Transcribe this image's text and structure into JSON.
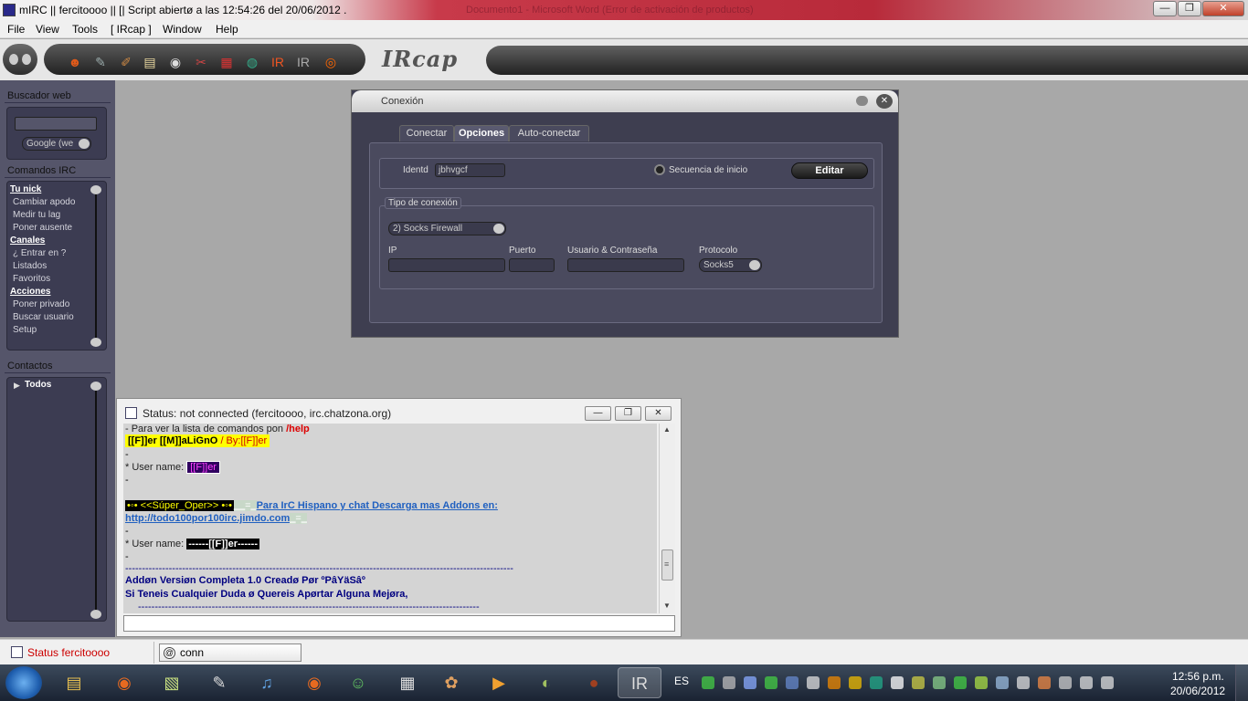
{
  "window": {
    "title": "mIRC || fercitoooo || [| Script abiertø a las 12:54:26 del 20/06/2012 .",
    "ghost_title": "Documento1 - Microsoft Word (Error de activación de productos)",
    "close_glyph": "✕",
    "max_glyph": "❐",
    "min_glyph": "—"
  },
  "menu": [
    "File",
    "View",
    "Tools",
    "[ IRcap ]",
    "Window",
    "Help"
  ],
  "toolbar": {
    "icons": [
      {
        "name": "smiley-icon",
        "glyph": "☻",
        "color": "#e05a1a"
      },
      {
        "name": "tools-icon",
        "glyph": "✎",
        "color": "#9aa"
      },
      {
        "name": "brush-icon",
        "glyph": "✐",
        "color": "#c84"
      },
      {
        "name": "note-icon",
        "glyph": "▤",
        "color": "#ead9a0"
      },
      {
        "name": "disk-icon",
        "glyph": "◉",
        "color": "#ddd"
      },
      {
        "name": "wrench-icon",
        "glyph": "✂",
        "color": "#c44"
      },
      {
        "name": "gift-icon",
        "glyph": "▦",
        "color": "#d33"
      },
      {
        "name": "globe-icon",
        "glyph": "◍",
        "color": "#3a8"
      },
      {
        "name": "ircap-icon",
        "glyph": "IR",
        "color": "#e52"
      },
      {
        "name": "ir-logo-icon",
        "glyph": "IR",
        "color": "#aaa"
      },
      {
        "name": "lifebuoy-icon",
        "glyph": "◎",
        "color": "#f60"
      }
    ],
    "logo": "IRcap"
  },
  "sidebar": {
    "web_title": "Buscador web",
    "web_select": "Google (we",
    "cmd_title": "Comandos IRC",
    "commands": [
      {
        "label": "Tu nick",
        "head": true
      },
      {
        "label": "Cambiar apodo",
        "head": false
      },
      {
        "label": "Medir tu lag",
        "head": false
      },
      {
        "label": "Poner ausente",
        "head": false
      },
      {
        "label": "Canales",
        "head": true
      },
      {
        "label": "¿ Entrar en ?",
        "head": false
      },
      {
        "label": "Listados",
        "head": false
      },
      {
        "label": "Favoritos",
        "head": false
      },
      {
        "label": "Acciones",
        "head": true
      },
      {
        "label": "Poner privado",
        "head": false
      },
      {
        "label": "Buscar usuario",
        "head": false
      },
      {
        "label": "Setup",
        "head": false
      }
    ],
    "contacts_title": "Contactos",
    "contacts_group": "Todos"
  },
  "dialog": {
    "title": "Conexión",
    "tabs": [
      "Conectar",
      "Opciones",
      "Auto-conectar"
    ],
    "active_tab": "Opciones",
    "ident_label": "Identd",
    "ident_value": "jbhvgcf",
    "radio_label": "Secuencia de inicio",
    "edit_button": "Editar",
    "conn_legend": "Tipo de conexión",
    "conn_type": "2) Socks Firewall",
    "ip_label": "IP",
    "port_label": "Puerto",
    "userpass_label": "Usuario & Contraseña",
    "protocol_label": "Protocolo",
    "protocol_value": "Socks5"
  },
  "status_window": {
    "title": "Status: not connected (fercitoooo, irc.chatzona.org)",
    "lines": {
      "l1a": "- Para ver la lista de comandos pon ",
      "l1b": "/help",
      "l2a": "[[F]]er [[M]]aLiGnO ",
      "l2b": " / By:[[F]]er",
      "dash": "-",
      "user_label": "* User name: ",
      "user_value1": "[[F]]er",
      "super_oper": "•◦• <<Súper_Oper>> •◦•",
      "equals": "‗‗=‗",
      "promo": "Para IrC Hispano y chat Descarga mas Addons en:",
      "url": "http://todo100por100irc.jimdo.com",
      "equals2": "‗=‗",
      "user_value2": "------[[F]]er------",
      "separator": "--------------------------------------------------------------------------------------------------------------------",
      "addon1": "Addøn Versiøn Completa 1.0 Creadø Pør  ºPâYäSâº",
      "addon2": "Si Teneis Cualquier Duda ø Quereis Apørtar Alguna Mejøra,",
      "separator2": "------------------------------------------------------------------------------------------------------"
    },
    "btn_min": "—",
    "btn_restore": "❐",
    "btn_close": "✕",
    "scroll_up": "▲",
    "scroll_down": "▼",
    "scroll_grip": "≡"
  },
  "switchbar": {
    "status_label": "Status fercitoooo",
    "input_value": "conn"
  },
  "taskbar": {
    "lang": "ES",
    "time": "12:56 p.m.",
    "date": "20/06/2012",
    "apps": [
      {
        "name": "explorer-icon",
        "glyph": "▤",
        "color": "#e8c050"
      },
      {
        "name": "firefox-icon",
        "glyph": "◉",
        "color": "#e86a20"
      },
      {
        "name": "sticky-notes-icon",
        "glyph": "▧",
        "color": "#c8e080"
      },
      {
        "name": "script-editor-icon",
        "glyph": "✎",
        "color": "#ddd"
      },
      {
        "name": "itunes-icon",
        "glyph": "♫",
        "color": "#60a0e0"
      },
      {
        "name": "firefox2-icon",
        "glyph": "◉",
        "color": "#e86a20"
      },
      {
        "name": "messenger-icon",
        "glyph": "☺",
        "color": "#60c060"
      },
      {
        "name": "notepad-icon",
        "glyph": "▦",
        "color": "#ddd"
      },
      {
        "name": "paint-icon",
        "glyph": "✿",
        "color": "#e0a060"
      },
      {
        "name": "media-player-icon",
        "glyph": "▶",
        "color": "#f0a030"
      },
      {
        "name": "tor-icon",
        "glyph": "◐",
        "color": "#a0c060"
      },
      {
        "name": "orb-icon",
        "glyph": "●",
        "color": "#a04020"
      },
      {
        "name": "ircap-task-icon",
        "glyph": "IR",
        "color": "#ddd"
      }
    ]
  }
}
